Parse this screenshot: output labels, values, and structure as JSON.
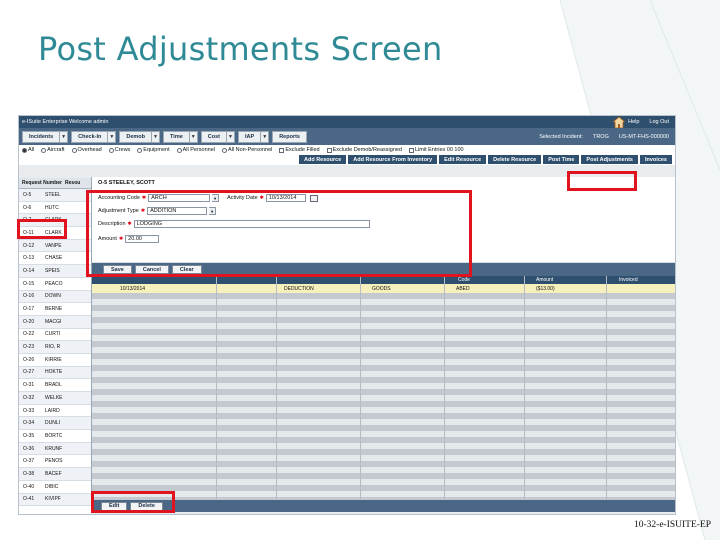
{
  "slide": {
    "title": "Post Adjustments Screen",
    "footer": "10-32-e-ISUITE-EP",
    "highlight_color": "#e0141e",
    "accent_color": "#2f8a96"
  },
  "app": {
    "title": "e-ISuite Enterprise    Welcome admin",
    "help": "Help",
    "logout": "Log Out",
    "menu": [
      {
        "label": "Incidents",
        "dropdown": true
      },
      {
        "label": "Check-In",
        "dropdown": true
      },
      {
        "label": "Demob",
        "dropdown": true
      },
      {
        "label": "Time",
        "dropdown": true
      },
      {
        "label": "Cost",
        "dropdown": true
      },
      {
        "label": "IAP",
        "dropdown": true
      },
      {
        "label": "Reports",
        "dropdown": false
      }
    ],
    "selected_incident_label": "Selected Incident:",
    "selected_incident_code": "TROG",
    "selected_incident_number": "US-MT-FHS-000000",
    "filters": [
      {
        "label": "All",
        "type": "radio",
        "checked": true
      },
      {
        "label": "Aircraft",
        "type": "radio",
        "checked": false
      },
      {
        "label": "Overhead",
        "type": "radio",
        "checked": false
      },
      {
        "label": "Crews",
        "type": "radio",
        "checked": false
      },
      {
        "label": "Equipment",
        "type": "radio",
        "checked": false
      },
      {
        "label": "All Personnel",
        "type": "radio",
        "checked": false
      },
      {
        "label": "All Non-Personnel",
        "type": "radio",
        "checked": false
      },
      {
        "label": "Exclude Filled",
        "type": "check",
        "checked": false
      },
      {
        "label": "Exclude Demob/Reassigned",
        "type": "check",
        "checked": false
      },
      {
        "label": "Limit Entries 00 100",
        "type": "check",
        "checked": false
      }
    ],
    "tabs": [
      "Add Resource",
      "Add Resource From Inventory",
      "Edit Resource",
      "Delete Resource",
      "Post Time",
      "Post Adjustments",
      "Invoices"
    ],
    "grid": {
      "headers": [
        "Request Number",
        "Resou"
      ],
      "rows": [
        [
          "O-5",
          "STEEL"
        ],
        [
          "O-6",
          "HUTC"
        ],
        [
          "O-7",
          "CLARK"
        ],
        [
          "O-11",
          "CLARK"
        ],
        [
          "O-12",
          "VANPE"
        ],
        [
          "O-13",
          "CHASE"
        ],
        [
          "O-14",
          "SPEIS"
        ],
        [
          "O-15",
          "PEACO"
        ],
        [
          "O-16",
          "DOWN"
        ],
        [
          "O-17",
          "BERNE"
        ],
        [
          "O-20",
          "MACGI"
        ],
        [
          "O-22",
          "CURTI"
        ],
        [
          "O-23",
          "RIO, R"
        ],
        [
          "O-26",
          "KIRRIE"
        ],
        [
          "O-27",
          "HOKTE"
        ],
        [
          "O-31",
          "BRADL"
        ],
        [
          "O-32",
          "WELKE"
        ],
        [
          "O-33",
          "LAIRD"
        ],
        [
          "O-34",
          "DUNLI"
        ],
        [
          "O-35",
          "BORTC"
        ],
        [
          "O-36",
          "KRUNF"
        ],
        [
          "O-37",
          "PENOS"
        ],
        [
          "O-38",
          "BACEF"
        ],
        [
          "O-40",
          "DIBIC"
        ],
        [
          "O-41",
          "KIVIPF"
        ]
      ]
    },
    "panel": {
      "header": "O-5   STEELEY, SCOTT",
      "accounting_code_label": "Accounting Code",
      "accounting_code_value": "ARCH",
      "activity_date_label": "Activity Date",
      "activity_date_value": "10/13/2014",
      "adjustment_type_label": "Adjustment Type",
      "adjustment_type_value": "ADDITION",
      "description_label": "Description",
      "description_value": "LODGING",
      "amount_label": "Amount",
      "amount_value": "20.00",
      "save": "Save",
      "cancel": "Cancel",
      "clear": "Clear",
      "table_headers": {
        "code": "Code",
        "amount": "Amount",
        "invoiced": "Invoiced"
      },
      "row": {
        "date": "10/13/2014",
        "type": "DEDUCTION",
        "desc": "GOODS",
        "code": "ABED",
        "amount": "($13.00)"
      },
      "edit": "Edit",
      "delete": "Delete"
    }
  }
}
